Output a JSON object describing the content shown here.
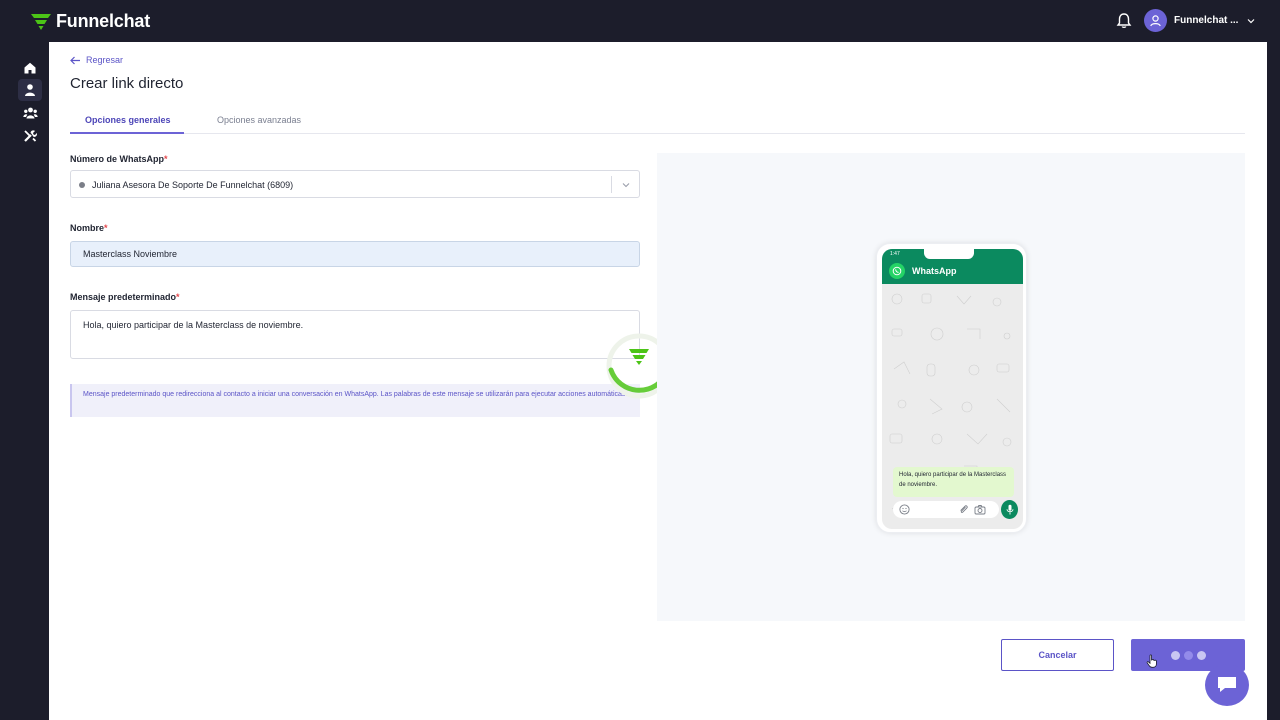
{
  "app": {
    "name": "Funnelchat",
    "accent": "#6c63d6",
    "brand_green": "#4cc417"
  },
  "header": {
    "user_name": "Funnelchat ...",
    "icons": [
      "bell-icon",
      "user-avatar-icon",
      "chevron-down-icon"
    ]
  },
  "sidebar": {
    "items": [
      {
        "icon": "home-icon",
        "active": false
      },
      {
        "icon": "user-icon",
        "active": true
      },
      {
        "icon": "users-group-icon",
        "active": false
      },
      {
        "icon": "tools-icon",
        "active": false
      }
    ],
    "help_icon": "help-circle-icon"
  },
  "page": {
    "back_label": "Regresar",
    "title": "Crear link directo"
  },
  "tabs": [
    {
      "label": "Opciones generales",
      "active": true
    },
    {
      "label": "Opciones avanzadas",
      "active": false
    }
  ],
  "form": {
    "whatsapp_number": {
      "label": "Número de WhatsApp",
      "required_mark": "*",
      "value": "Juliana Asesora De Soporte De Funnelchat (6809)"
    },
    "name": {
      "label": "Nombre",
      "required_mark": "*",
      "value": "Masterclass Noviembre"
    },
    "message": {
      "label": "Mensaje predeterminado",
      "required_mark": "*",
      "value": "Hola, quiero participar de la Masterclass de noviembre."
    },
    "help_text": "Mensaje predeterminado que redirecciona al contacto a iniciar una conversación en WhatsApp. Las palabras de este mensaje se utilizarán para ejecutar acciones automáticas."
  },
  "preview": {
    "status_time": "1:47",
    "app_title": "WhatsApp",
    "bubble_text": "Hola, quiero participar de la Masterclass de noviembre."
  },
  "footer": {
    "cancel_label": "Cancelar",
    "submit_state": "loading"
  }
}
